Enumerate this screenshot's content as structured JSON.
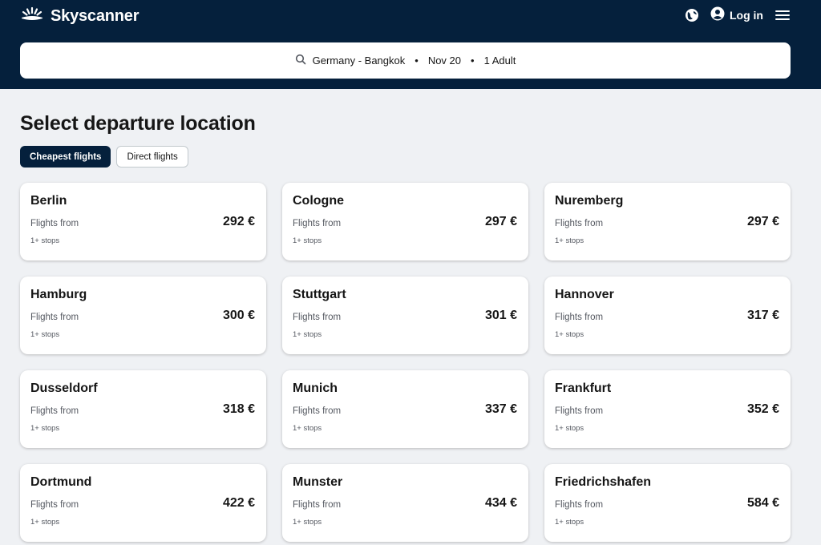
{
  "header": {
    "brand": "Skyscanner",
    "login_label": "Log in",
    "icons": [
      "sun-logo-icon",
      "globe-icon",
      "user-icon",
      "menu-icon"
    ]
  },
  "search": {
    "route": "Germany - Bangkok",
    "date": "Nov 20",
    "passengers": "1 Adult",
    "separator": "•"
  },
  "page": {
    "title": "Select departure location"
  },
  "tabs": [
    {
      "label": "Cheapest flights",
      "active": true
    },
    {
      "label": "Direct flights",
      "active": false
    }
  ],
  "locations": [
    {
      "city": "Berlin",
      "from_label": "Flights from",
      "stops": "1+ stops",
      "price": "292 €"
    },
    {
      "city": "Cologne",
      "from_label": "Flights from",
      "stops": "1+ stops",
      "price": "297 €"
    },
    {
      "city": "Nuremberg",
      "from_label": "Flights from",
      "stops": "1+ stops",
      "price": "297 €"
    },
    {
      "city": "Hamburg",
      "from_label": "Flights from",
      "stops": "1+ stops",
      "price": "300 €"
    },
    {
      "city": "Stuttgart",
      "from_label": "Flights from",
      "stops": "1+ stops",
      "price": "301 €"
    },
    {
      "city": "Hannover",
      "from_label": "Flights from",
      "stops": "1+ stops",
      "price": "317 €"
    },
    {
      "city": "Dusseldorf",
      "from_label": "Flights from",
      "stops": "1+ stops",
      "price": "318 €"
    },
    {
      "city": "Munich",
      "from_label": "Flights from",
      "stops": "1+ stops",
      "price": "337 €"
    },
    {
      "city": "Frankfurt",
      "from_label": "Flights from",
      "stops": "1+ stops",
      "price": "352 €"
    },
    {
      "city": "Dortmund",
      "from_label": "Flights from",
      "stops": "1+ stops",
      "price": "422 €"
    },
    {
      "city": "Munster",
      "from_label": "Flights from",
      "stops": "1+ stops",
      "price": "434 €"
    },
    {
      "city": "Friedrichshafen",
      "from_label": "Flights from",
      "stops": "1+ stops",
      "price": "584 €"
    }
  ],
  "colors": {
    "header_bg": "#05203c",
    "page_bg": "#eff1f4",
    "active_tab": "#05203c"
  }
}
